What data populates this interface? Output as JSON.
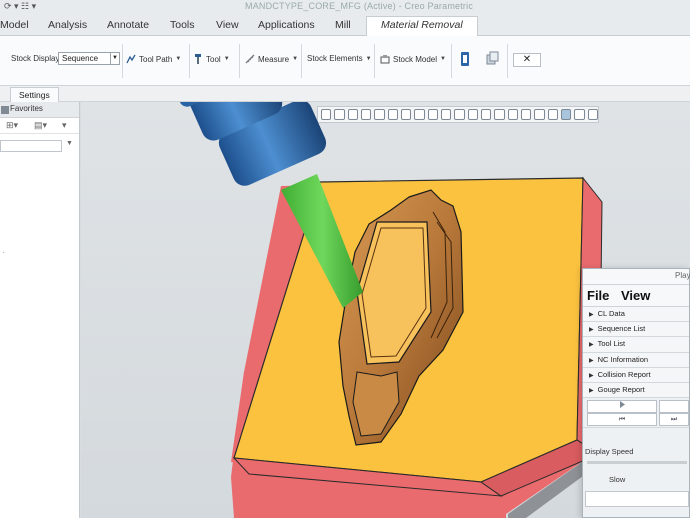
{
  "window": {
    "title": "MANDCTYPE_CORE_MFG (Active) - Creo Parametric"
  },
  "ribbon_tabs": [
    {
      "label": "Model",
      "active": false
    },
    {
      "label": "Analysis",
      "active": false
    },
    {
      "label": "Annotate",
      "active": false
    },
    {
      "label": "Tools",
      "active": false
    },
    {
      "label": "View",
      "active": false
    },
    {
      "label": "Applications",
      "active": false
    },
    {
      "label": "Mill",
      "active": false
    },
    {
      "label": "Material Removal",
      "active": true
    }
  ],
  "ribbon": {
    "stock_display_label": "Stock Display",
    "stock_display_value": "Sequence",
    "tool_path_label": "Tool Path",
    "tool_label": "Tool",
    "measure_label": "Measure",
    "stock_elements_label": "Stock Elements",
    "stock_model_label": "Stock Model",
    "close_label": "✕"
  },
  "subtabs": {
    "settings_label": "Settings"
  },
  "left_panel": {
    "favorites_label": "Favorites"
  },
  "dialog": {
    "title": "Play",
    "menu": {
      "file": "File",
      "view": "View"
    },
    "rows": [
      {
        "label": "CL Data"
      },
      {
        "label": "Sequence List"
      },
      {
        "label": "Tool List"
      },
      {
        "label": "NC Information"
      },
      {
        "label": "Collision Report"
      },
      {
        "label": "Gouge Report"
      }
    ],
    "display_speed_label": "Display Speed",
    "slow_label": "Slow"
  },
  "colors": {
    "stock_top": "#fbc23f",
    "stock_side_red": "#ea6b6e",
    "tool_holder_blue": "#2f6fb3",
    "tool_shank_green": "#55c444",
    "part_bronze": "#b8783a",
    "accent_dialog_bg": "#eef1f3"
  }
}
